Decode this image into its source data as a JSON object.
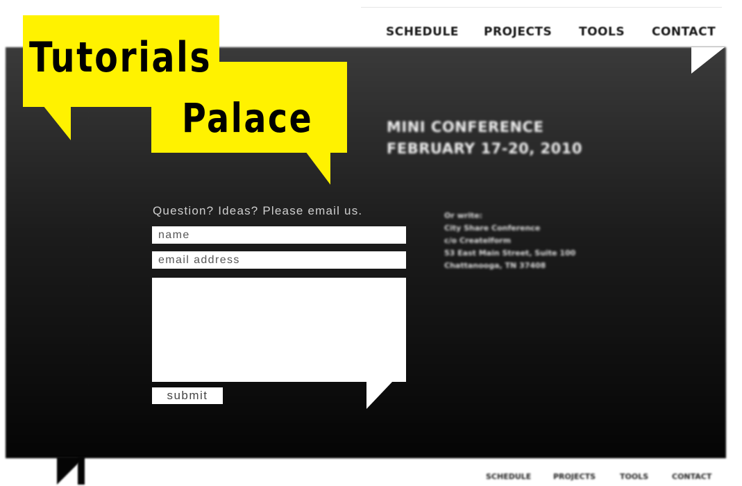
{
  "logo": {
    "line1": "Tutorials",
    "line2": "Palace",
    "color": "#fff200"
  },
  "nav_top": {
    "items": [
      "SCHEDULE",
      "PROJECTS",
      "TOOLS",
      "CONTACT"
    ]
  },
  "event": {
    "title": "MINI CONFERENCE",
    "dates": "FEBRUARY 17-20, 2010"
  },
  "contact_form": {
    "prompt": "Question? Ideas? Please email us.",
    "name_placeholder": "name",
    "email_placeholder": "email address",
    "message_value": "",
    "submit_label": "submit"
  },
  "mailing_address": {
    "lines": [
      "Or write:",
      "City Share Conference",
      "c/o Createlform",
      "53 East Main Street, Suite 100",
      "Chattanooga, TN 37408"
    ]
  },
  "nav_bottom": {
    "items": [
      "SCHEDULE",
      "PROJECTS",
      "TOOLS",
      "CONTACT"
    ]
  },
  "colors": {
    "panel_dark": "#050505",
    "panel_light": "#3a3a3a",
    "accent_yellow": "#fff200"
  }
}
